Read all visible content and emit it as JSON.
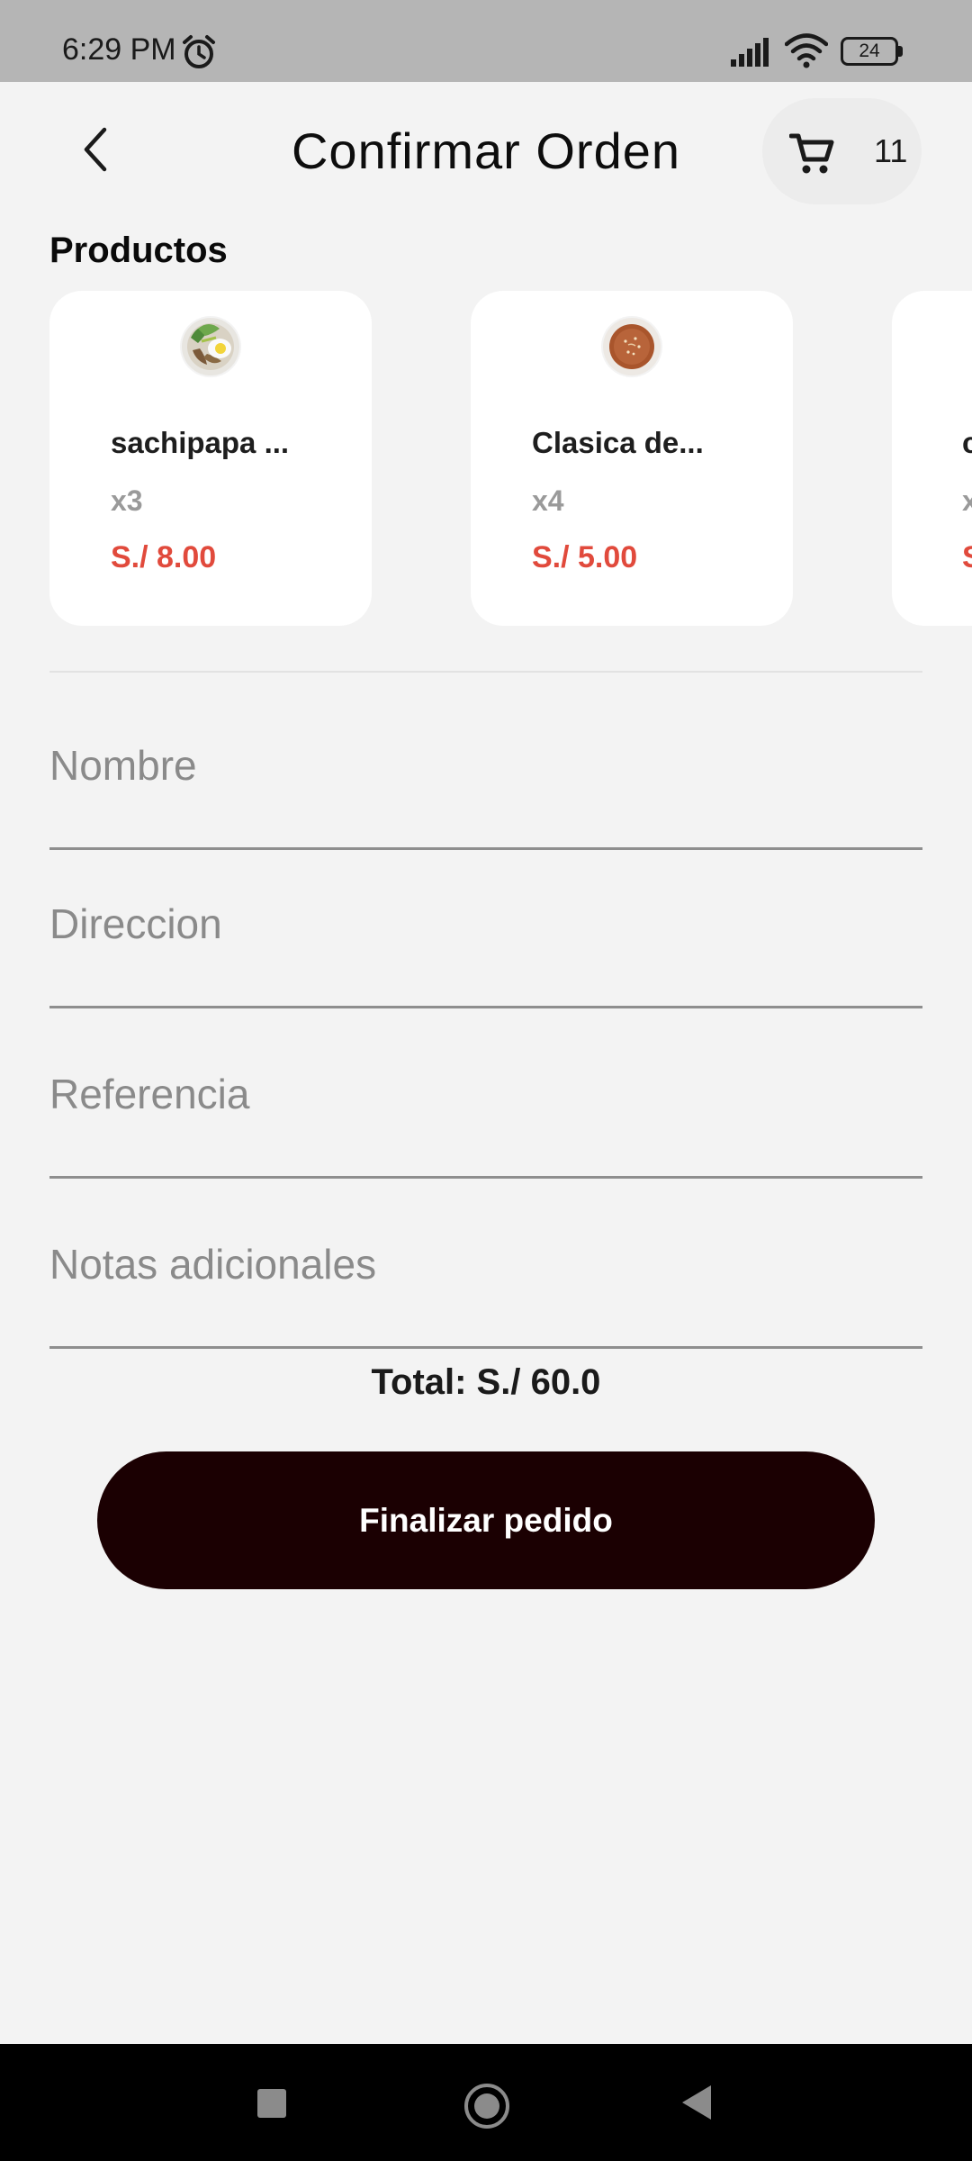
{
  "status_bar": {
    "time": "6:29 PM",
    "battery": "24",
    "icons": [
      "alarm-icon",
      "signal-icon",
      "wifi-icon",
      "battery-icon"
    ]
  },
  "header": {
    "title": "Confirmar Orden",
    "back_icon": "chevron-left-icon",
    "cart_icon": "cart-icon",
    "cart_count": "11"
  },
  "products": {
    "title": "Productos",
    "items": [
      {
        "name": "sachipapa ...",
        "qty": "x3",
        "price": "S./ 8.00",
        "image": "salad-plate-thumbnail"
      },
      {
        "name": "Clasica de...",
        "qty": "x4",
        "price": "S./ 5.00",
        "image": "burger-thumbnail"
      },
      {
        "name": "c",
        "qty": "x",
        "price": "S",
        "image": ""
      }
    ]
  },
  "form": {
    "nombre_placeholder": "Nombre",
    "direccion_placeholder": "Direccion",
    "referencia_placeholder": "Referencia",
    "notas_placeholder": "Notas adicionales"
  },
  "total": "Total: S./ 60.0",
  "finalize_label": "Finalizar pedido",
  "colors": {
    "price": "#e14a3c",
    "button": "#1b0002",
    "background": "#f3f3f3"
  }
}
